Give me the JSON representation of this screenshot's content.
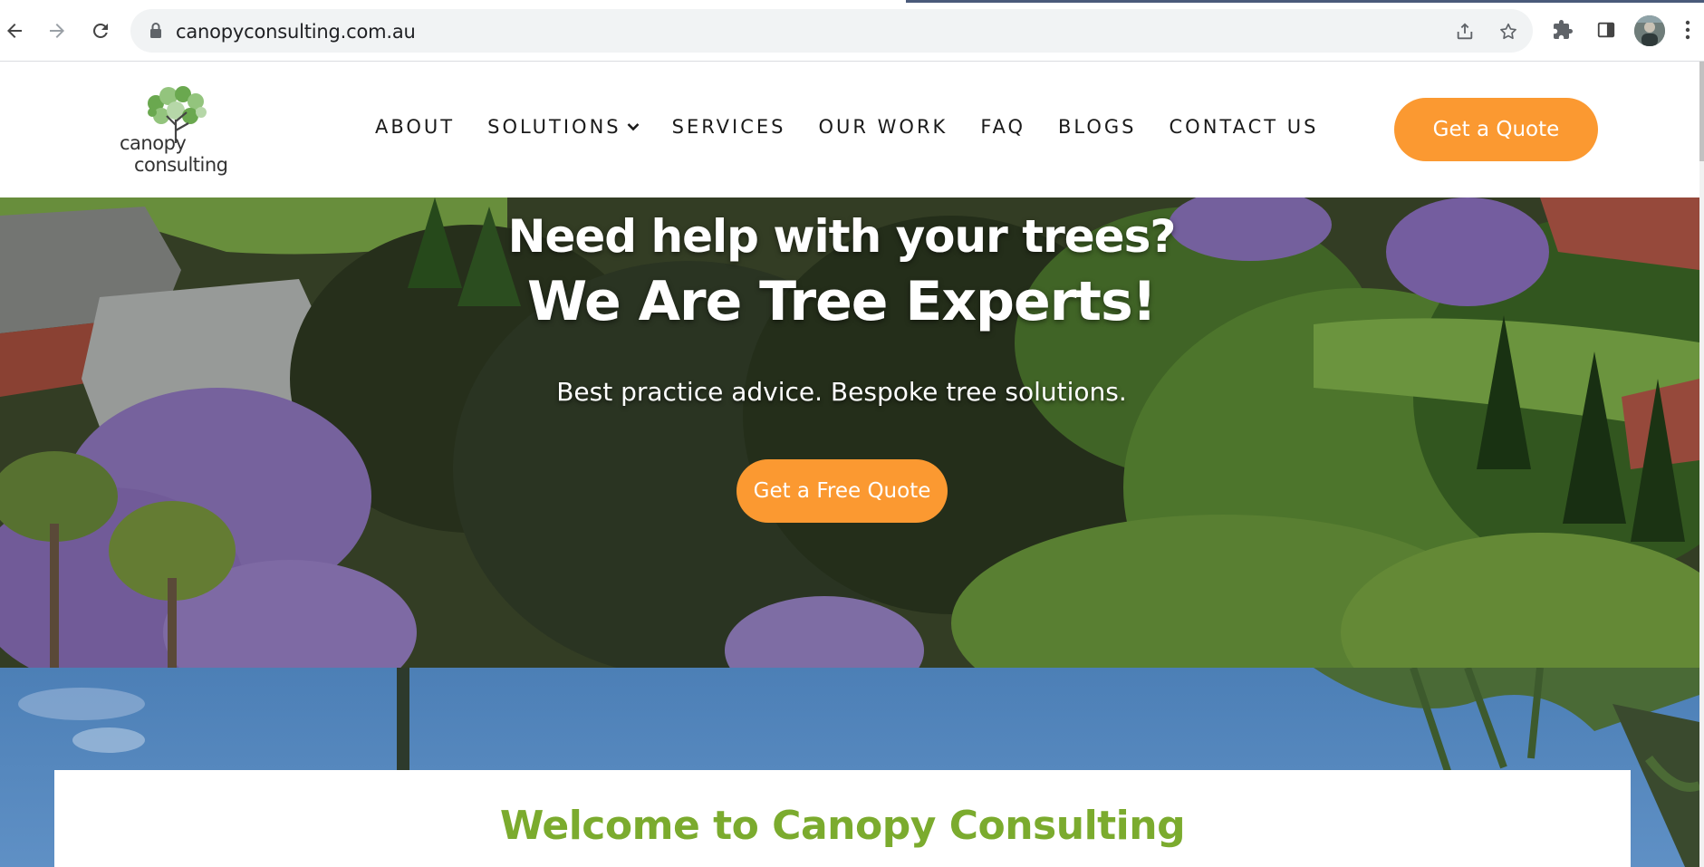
{
  "browser": {
    "url": "canopyconsulting.com.au",
    "back_icon": "arrow-left-icon",
    "forward_icon": "arrow-right-icon",
    "reload_icon": "reload-icon",
    "lock_icon": "lock-icon",
    "share_icon": "share-icon",
    "bookmark_icon": "star-icon",
    "extensions_icon": "puzzle-icon",
    "sidepanel_icon": "side-panel-icon",
    "menu_icon": "kebab-menu-icon"
  },
  "site": {
    "logo_line1": "canopy",
    "logo_line2": "consulting",
    "nav": [
      {
        "label": "ABOUT"
      },
      {
        "label": "SOLUTIONS",
        "has_dropdown": true
      },
      {
        "label": "SERVICES"
      },
      {
        "label": "OUR WORK"
      },
      {
        "label": "FAQ"
      },
      {
        "label": "BLOGS"
      },
      {
        "label": "CONTACT US"
      }
    ],
    "quote_button": "Get a Quote"
  },
  "hero": {
    "title_line1": "Need help with your trees?",
    "title_line2": "We Are Tree Experts!",
    "subtitle": "Best practice advice. Bespoke tree solutions.",
    "cta": "Get a Free Quote"
  },
  "welcome": {
    "title": "Welcome to Canopy Consulting"
  },
  "colors": {
    "accent_orange": "#fb9931",
    "brand_green": "#7bab2e",
    "omnibox_bg": "#f1f3f4"
  }
}
